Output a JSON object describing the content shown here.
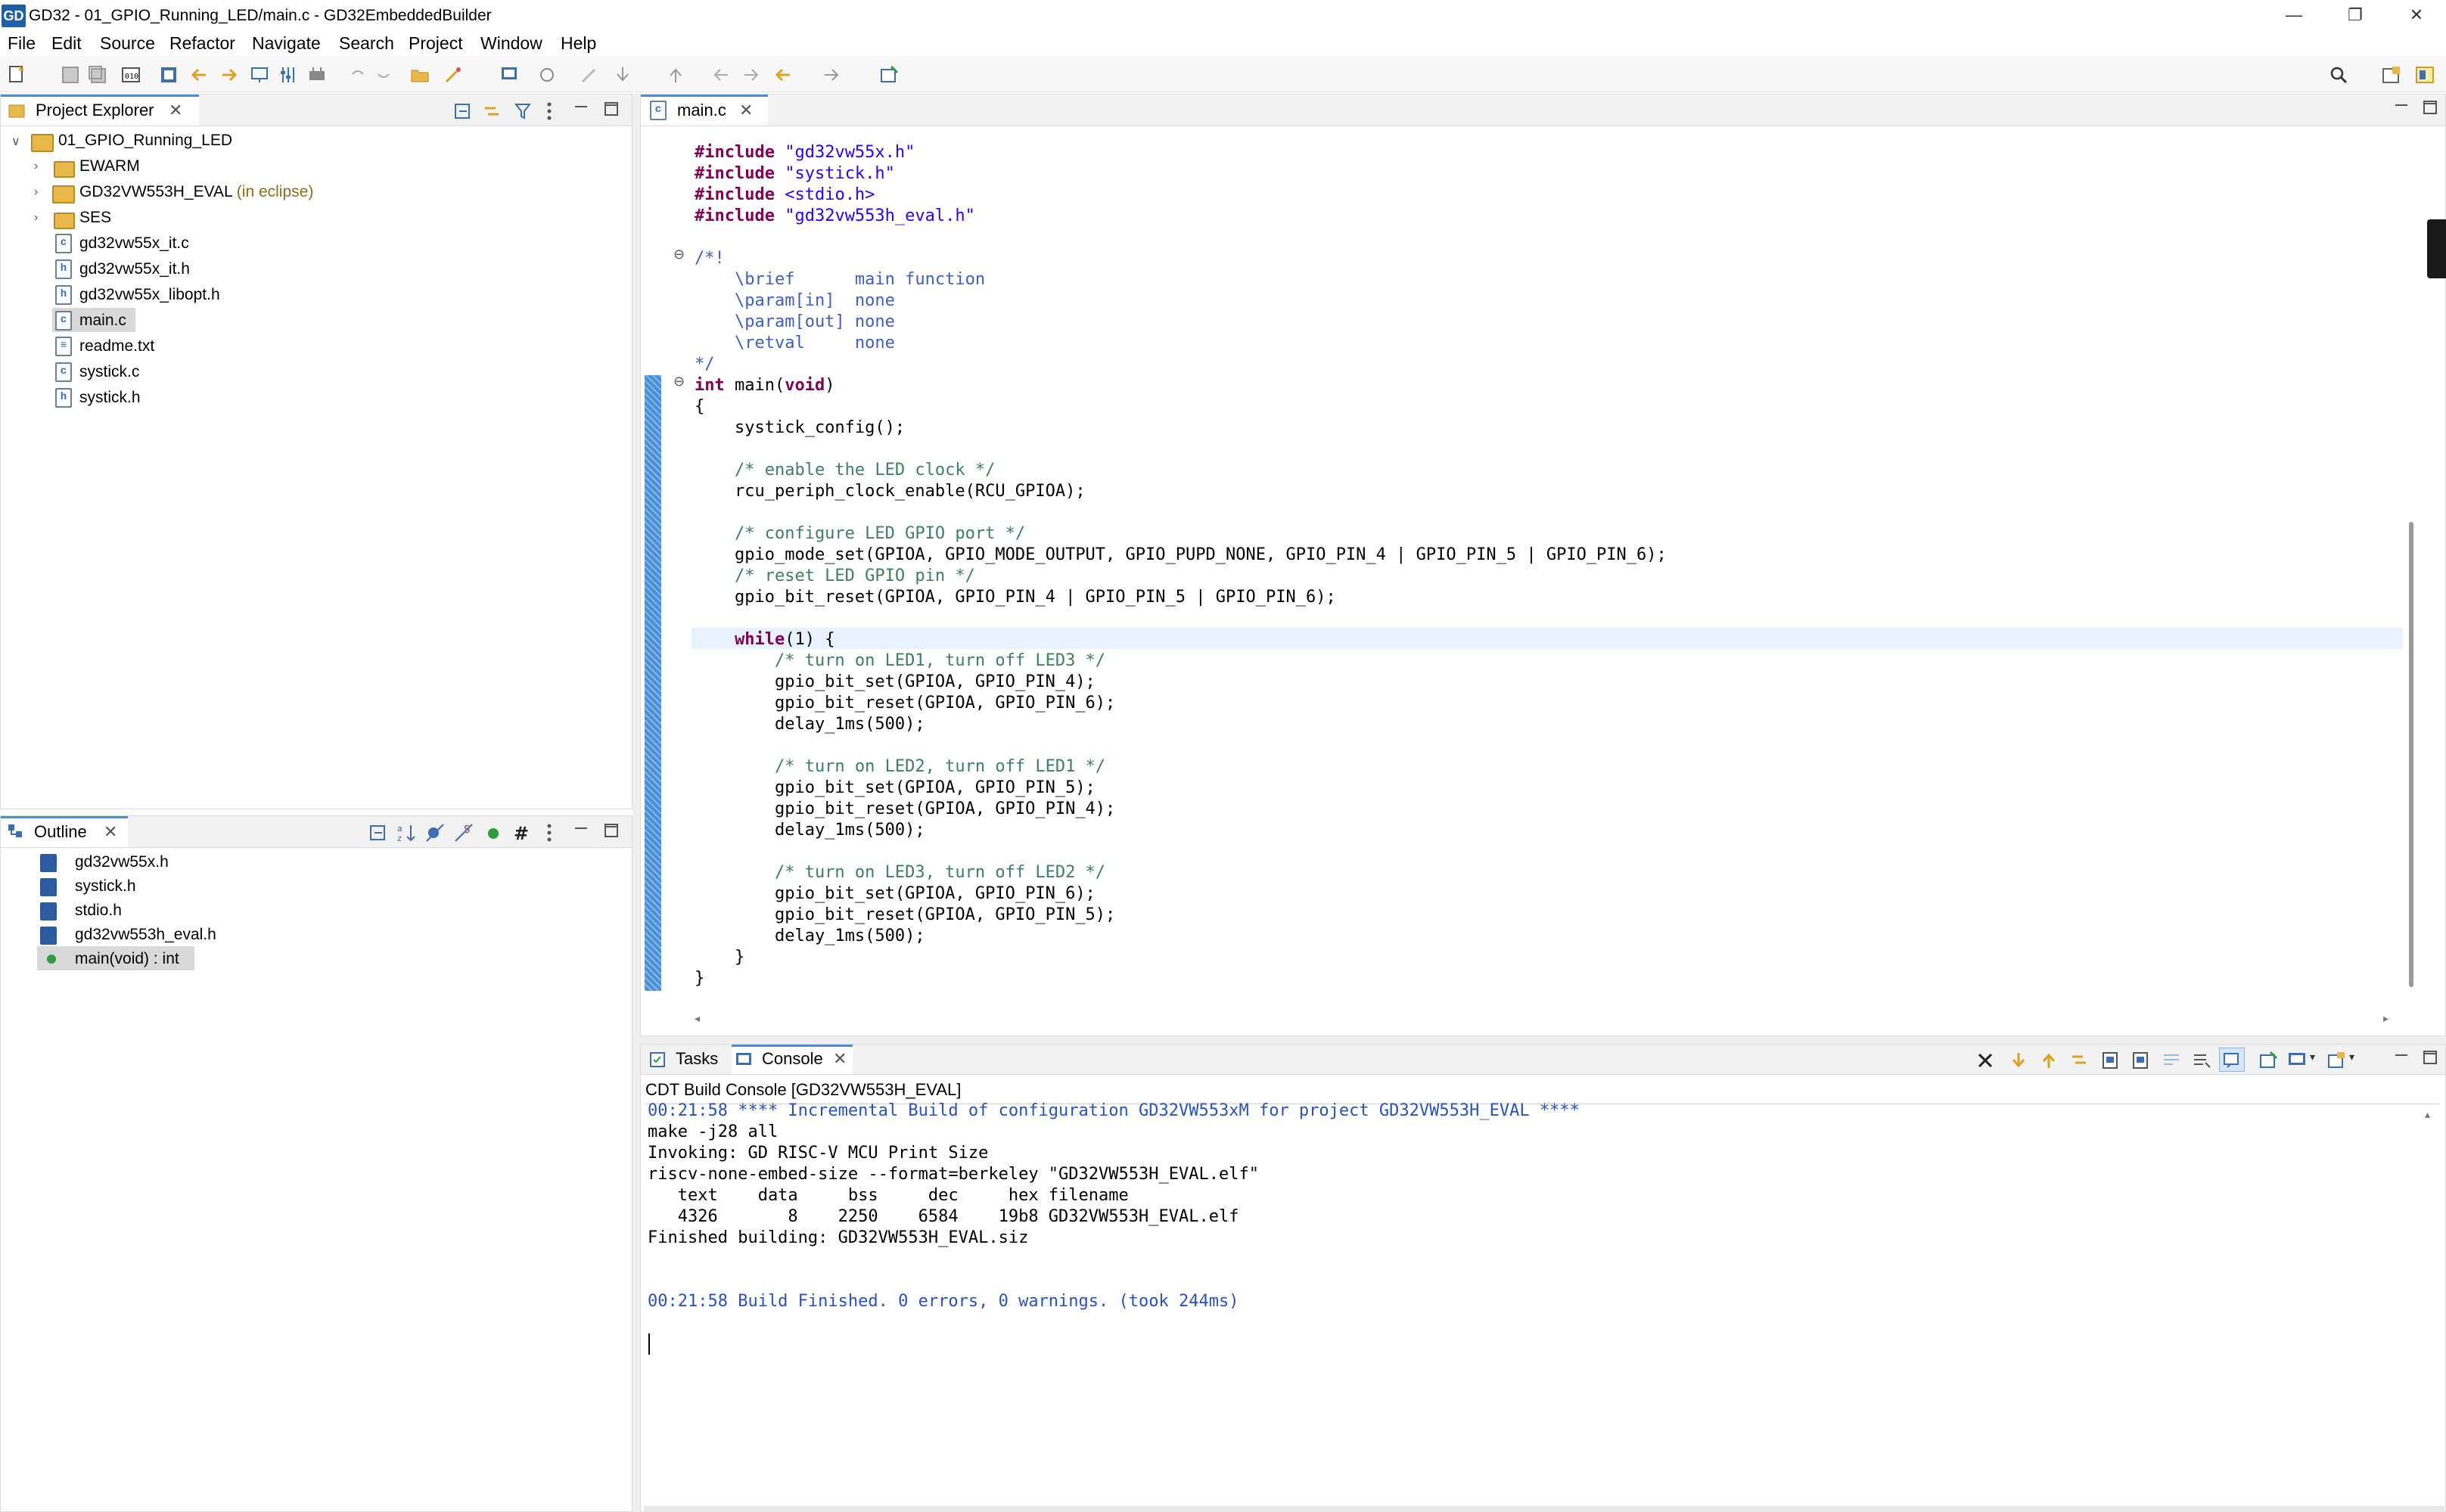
{
  "window": {
    "app_logo": "GD",
    "title": "GD32 - 01_GPIO_Running_LED/main.c - GD32EmbeddedBuilder",
    "minimize": "—",
    "maximize": "❐",
    "close": "✕"
  },
  "menu": [
    "File",
    "Edit",
    "Source",
    "Refactor",
    "Navigate",
    "Search",
    "Project",
    "Window",
    "Help"
  ],
  "project_explorer": {
    "tab_label": "Project Explorer",
    "root": "01_GPIO_Running_LED",
    "items": [
      {
        "label": "EWARM",
        "type": "folder"
      },
      {
        "label": "GD32VW553H_EVAL",
        "suffix": "(in eclipse)",
        "type": "project"
      },
      {
        "label": "SES",
        "type": "folder"
      },
      {
        "label": "gd32vw55x_it.c",
        "type": "file"
      },
      {
        "label": "gd32vw55x_it.h",
        "type": "file"
      },
      {
        "label": "gd32vw55x_libopt.h",
        "type": "file"
      },
      {
        "label": "main.c",
        "type": "file",
        "selected": true
      },
      {
        "label": "readme.txt",
        "type": "file"
      },
      {
        "label": "systick.c",
        "type": "file"
      },
      {
        "label": "systick.h",
        "type": "file"
      }
    ]
  },
  "outline": {
    "tab_label": "Outline",
    "items": [
      {
        "label": "gd32vw55x.h"
      },
      {
        "label": "systick.h"
      },
      {
        "label": "stdio.h"
      },
      {
        "label": "gd32vw553h_eval.h"
      },
      {
        "label": "main(void) : int",
        "selected": true
      }
    ]
  },
  "editor": {
    "tab_label": "main.c",
    "lines": [
      "#include \"gd32vw55x.h\"",
      "#include \"systick.h\"",
      "#include <stdio.h>",
      "#include \"gd32vw553h_eval.h\"",
      "",
      "/*!",
      "    \\brief      main function",
      "    \\param[in]  none",
      "    \\param[out] none",
      "    \\retval     none",
      "*/",
      "int main(void)",
      "{",
      "    systick_config();",
      "",
      "    /* enable the LED clock */",
      "    rcu_periph_clock_enable(RCU_GPIOA);",
      "",
      "    /* configure LED GPIO port */",
      "    gpio_mode_set(GPIOA, GPIO_MODE_OUTPUT, GPIO_PUPD_NONE, GPIO_PIN_4 | GPIO_PIN_5 | GPIO_PIN_6);",
      "    /* reset LED GPIO pin */",
      "    gpio_bit_reset(GPIOA, GPIO_PIN_4 | GPIO_PIN_5 | GPIO_PIN_6);",
      "",
      "    while(1) {",
      "        /* turn on LED1, turn off LED3 */",
      "        gpio_bit_set(GPIOA, GPIO_PIN_4);",
      "        gpio_bit_reset(GPIOA, GPIO_PIN_6);",
      "        delay_1ms(500);",
      "",
      "        /* turn on LED2, turn off LED1 */",
      "        gpio_bit_set(GPIOA, GPIO_PIN_5);",
      "        gpio_bit_reset(GPIOA, GPIO_PIN_4);",
      "        delay_1ms(500);",
      "",
      "        /* turn on LED3, turn off LED2 */",
      "        gpio_bit_set(GPIOA, GPIO_PIN_6);",
      "        gpio_bit_reset(GPIOA, GPIO_PIN_5);",
      "        delay_1ms(500);",
      "    }",
      "}"
    ]
  },
  "bottom_tabs": {
    "tasks": "Tasks",
    "console": "Console"
  },
  "console": {
    "header": "CDT Build Console [GD32VW553H_EVAL]",
    "lines": [
      {
        "text": "00:21:58 **** Incremental Build of configuration GD32VW553xM for project GD32VW553H_EVAL ****",
        "style": "blue"
      },
      {
        "text": "make -j28 all",
        "style": "normal"
      },
      {
        "text": "Invoking: GD RISC-V MCU Print Size",
        "style": "normal"
      },
      {
        "text": "riscv-none-embed-size --format=berkeley \"GD32VW553H_EVAL.elf\"",
        "style": "normal"
      },
      {
        "text": "   text    data     bss     dec     hex filename",
        "style": "normal"
      },
      {
        "text": "   4326       8    2250    6584    19b8 GD32VW553H_EVAL.elf",
        "style": "normal"
      },
      {
        "text": "Finished building: GD32VW553H_EVAL.siz",
        "style": "normal"
      },
      {
        "text": "",
        "style": "normal"
      },
      {
        "text": "",
        "style": "normal"
      },
      {
        "text": "00:21:58 Build Finished. 0 errors, 0 warnings. (took 244ms)",
        "style": "blue"
      }
    ]
  },
  "colors": {
    "keyword": "#7f0055",
    "string": "#2a00ff",
    "comment": "#3f7f5f",
    "doc_comment": "#3f5fbf",
    "console_info": "#2a52be",
    "active_tab_accent": "#4a90d9",
    "current_line": "#e8f2fe",
    "change_bar": "#4a90d9"
  }
}
